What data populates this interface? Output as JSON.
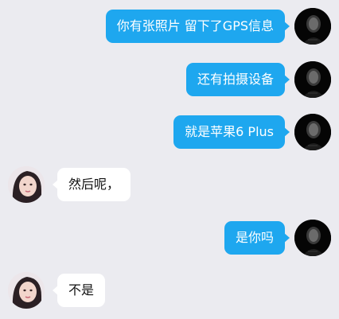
{
  "colors": {
    "background": "#ebebf0",
    "outgoing_bubble": "#1ea7ef",
    "incoming_bubble": "#ffffff"
  },
  "messages": [
    {
      "direction": "out",
      "text": "你有张照片 留下了GPS信息",
      "avatar": "dark-portrait-avatar"
    },
    {
      "direction": "out",
      "text": "还有拍摄设备",
      "avatar": "dark-portrait-avatar"
    },
    {
      "direction": "out",
      "text": "就是苹果6 Plus",
      "avatar": "dark-portrait-avatar"
    },
    {
      "direction": "in",
      "text": "然后呢，",
      "avatar": "girl-portrait-avatar"
    },
    {
      "direction": "out",
      "text": "是你吗",
      "avatar": "dark-portrait-avatar"
    },
    {
      "direction": "in",
      "text": "不是",
      "avatar": "girl-portrait-avatar"
    }
  ]
}
